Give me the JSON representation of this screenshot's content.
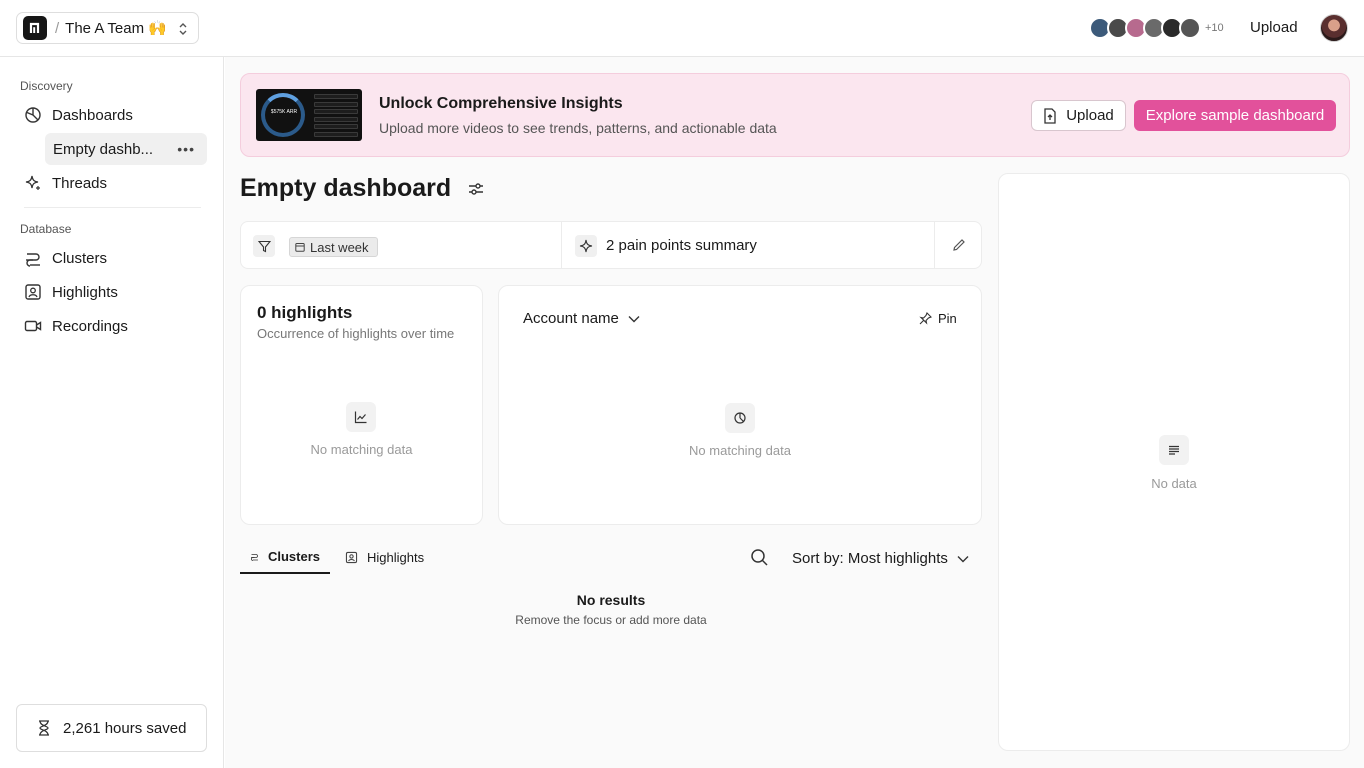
{
  "header": {
    "separator": "/",
    "team_name": "The A Team 🙌",
    "members_more": "+10",
    "upload_label": "Upload",
    "avatar_colors": [
      "#3c5a7a",
      "#4a4a4a",
      "#b76a8e",
      "#6a6a6a",
      "#2a2a2a",
      "#555555"
    ]
  },
  "sidebar": {
    "discovery_label": "Discovery",
    "dashboards_label": "Dashboards",
    "active_dashboard": "Empty dashb...",
    "threads_label": "Threads",
    "database_label": "Database",
    "clusters_label": "Clusters",
    "highlights_label": "Highlights",
    "recordings_label": "Recordings",
    "hours_saved": "2,261 hours saved"
  },
  "banner": {
    "thumb_arr": "$575K ARR",
    "title": "Unlock Comprehensive Insights",
    "subtitle": "Upload more videos to see trends, patterns, and actionable data",
    "upload_label": "Upload",
    "explore_label": "Explore sample dashboard",
    "accent": "#e2519b"
  },
  "dashboard": {
    "title": "Empty dashboard",
    "filter_chip": "Last week",
    "summary_label": "2 pain points summary"
  },
  "highlights_card": {
    "title": "0 highlights",
    "subtitle": "Occurrence of highlights over time",
    "empty_text": "No matching data"
  },
  "account_card": {
    "dropdown_label": "Account name",
    "pin_label": "Pin",
    "empty_text": "No matching data"
  },
  "tabs": {
    "clusters": "Clusters",
    "highlights": "Highlights",
    "sort_label": "Sort by: Most highlights"
  },
  "results": {
    "title": "No results",
    "subtitle": "Remove the focus or add more data"
  },
  "right_panel": {
    "empty_text": "No data"
  }
}
